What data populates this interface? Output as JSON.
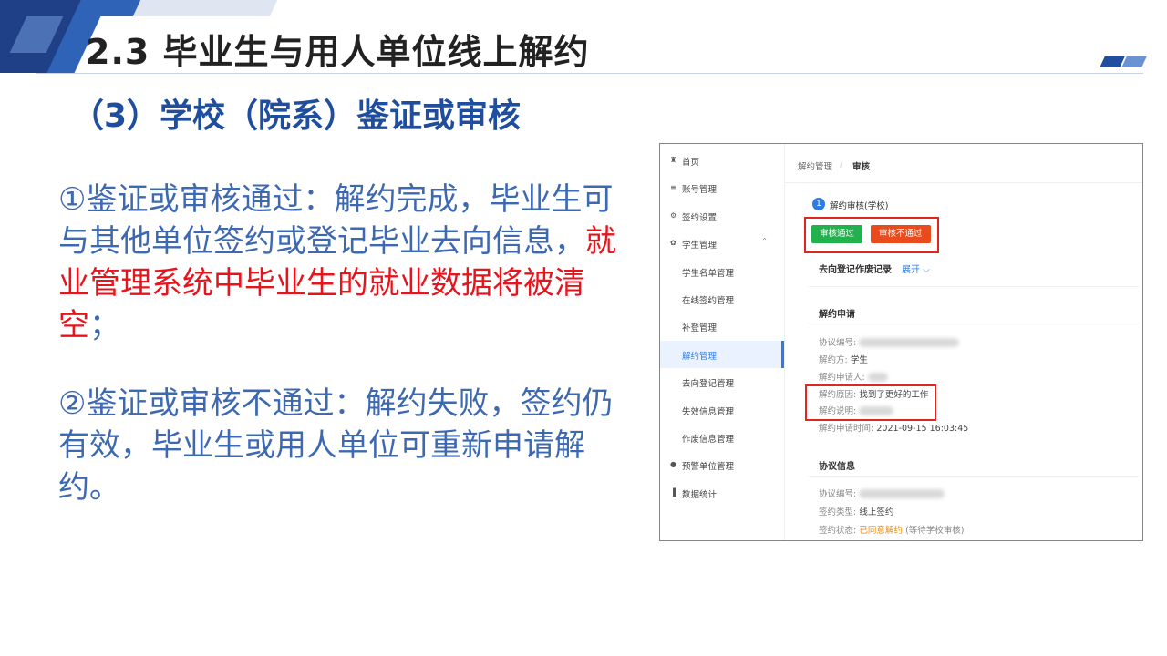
{
  "slide": {
    "title": "2.3 毕业生与用人单位线上解约",
    "subtitle": "（3）学校（院系）鉴证或审核",
    "para1_normal": "①鉴证或审核通过：解约完成，毕业生可与其他单位签约或登记毕业去向信息，",
    "para1_red": "就业管理系统中毕业生的就业数据将被清空",
    "para1_end": "；",
    "para2": "②鉴证或审核不通过：解约失败，签约仍有效，毕业生或用人单位可重新申请解约。",
    "colors": {
      "title_blue": "#1f4e9e",
      "text_blue": "#3d69b3",
      "highlight_red": "#e8141c"
    }
  },
  "app": {
    "sidebar": [
      {
        "icon": "home-icon",
        "glyph": "♜",
        "label": "首页"
      },
      {
        "icon": "list-icon",
        "glyph": "≡",
        "label": "账号管理"
      },
      {
        "icon": "settings-icon",
        "glyph": "⚙",
        "label": "签约设置"
      },
      {
        "icon": "user-icon",
        "glyph": "✿",
        "label": "学生管理",
        "expanded": true
      },
      {
        "label": "学生名单管理"
      },
      {
        "label": "在线签约管理"
      },
      {
        "label": "补登管理"
      },
      {
        "label": "解约管理",
        "active": true
      },
      {
        "label": "去向登记管理"
      },
      {
        "label": "失效信息管理"
      },
      {
        "label": "作废信息管理"
      },
      {
        "icon": "alert-icon",
        "glyph": "●",
        "label": "预警单位管理"
      },
      {
        "icon": "chart-icon",
        "glyph": "▐",
        "label": "数据统计"
      }
    ],
    "breadcrumb": {
      "parent": "解约管理",
      "separator": "/",
      "current": "审核"
    },
    "step": {
      "number": "1",
      "label": "解约审核(学校)"
    },
    "buttons": {
      "approve": "审核通过",
      "reject": "审核不通过"
    },
    "records": {
      "label": "去向登记作废记录",
      "toggle": "展开"
    },
    "application": {
      "heading": "解约申请",
      "fields": {
        "agreement_no": "协议编号:",
        "party": "解约方:",
        "party_value": "学生",
        "applicant": "解约申请人:",
        "reason": "解约原因:",
        "reason_value": "找到了更好的工作",
        "note": "解约说明:",
        "time": "解约申请时间:",
        "time_value": "2021-09-15 16:03:45"
      }
    },
    "agreement": {
      "heading": "协议信息",
      "fields": {
        "agreement_no": "协议编号:",
        "type": "签约类型:",
        "type_value": "线上签约",
        "status": "签约状态:",
        "status_value": "已同意解约",
        "status_note": "(等待学校审核)"
      }
    },
    "colors": {
      "primary": "#2d7be5",
      "approve": "#22b14c",
      "reject": "#ea4b1d",
      "status": "#f08a00"
    }
  }
}
